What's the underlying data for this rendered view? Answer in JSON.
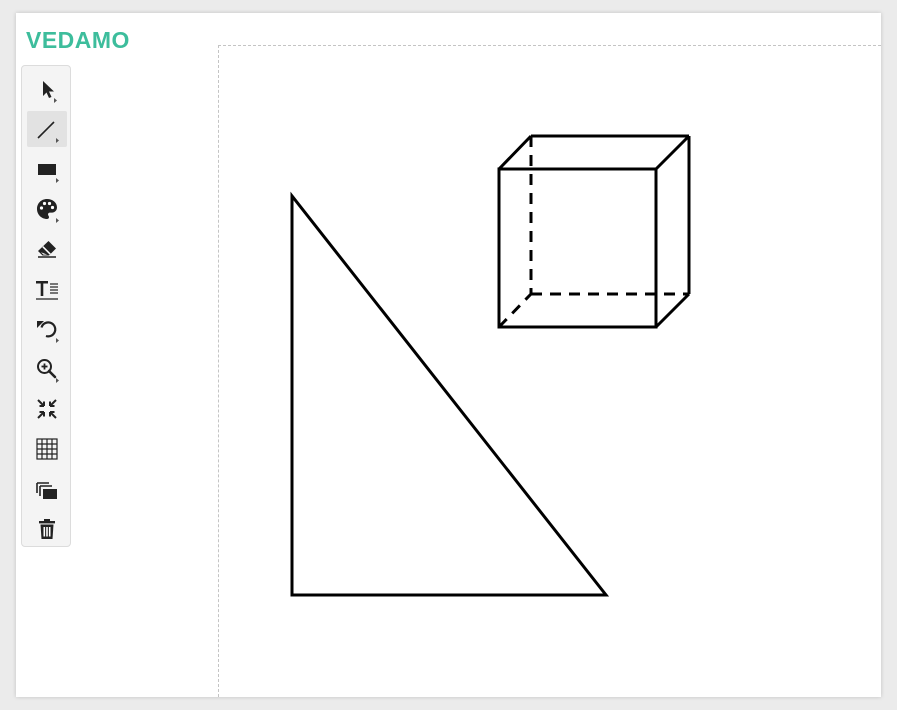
{
  "app": {
    "logo_text": "VEDAMO",
    "brand_color": "#3dbd9c"
  },
  "toolbar": {
    "tools": [
      {
        "name": "select",
        "icon": "cursor-arrow-icon",
        "has_submenu": true,
        "active": false
      },
      {
        "name": "line",
        "icon": "line-icon",
        "has_submenu": true,
        "active": true
      },
      {
        "name": "shape",
        "icon": "rectangle-icon",
        "has_submenu": true,
        "active": false
      },
      {
        "name": "color",
        "icon": "palette-icon",
        "has_submenu": true,
        "active": false
      },
      {
        "name": "eraser",
        "icon": "eraser-icon",
        "has_submenu": false,
        "active": false
      },
      {
        "name": "text",
        "icon": "text-icon",
        "has_submenu": false,
        "active": false
      },
      {
        "name": "undo",
        "icon": "undo-icon",
        "has_submenu": true,
        "active": false
      },
      {
        "name": "zoom",
        "icon": "zoom-in-icon",
        "has_submenu": true,
        "active": false
      },
      {
        "name": "fit",
        "icon": "collapse-arrows-icon",
        "has_submenu": false,
        "active": false
      },
      {
        "name": "grid",
        "icon": "grid-icon",
        "has_submenu": false,
        "active": false
      },
      {
        "name": "layers",
        "icon": "layers-icon",
        "has_submenu": false,
        "active": false
      },
      {
        "name": "delete",
        "icon": "trash-icon",
        "has_submenu": false,
        "active": false
      }
    ]
  },
  "whiteboard": {
    "stroke_color": "#000000",
    "shapes": [
      "right-triangle",
      "cube"
    ]
  }
}
